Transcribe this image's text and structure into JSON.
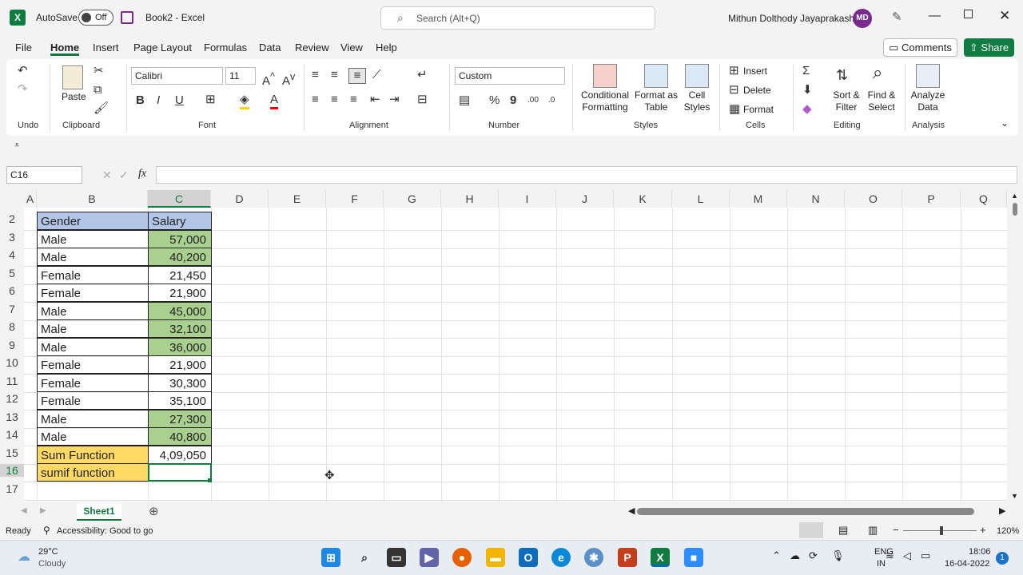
{
  "titlebar": {
    "autosave_label": "AutoSave",
    "autosave_state": "Off",
    "doc_title": "Book2  -  Excel",
    "search_placeholder": "Search (Alt+Q)",
    "user_name": "Mithun Dolthody Jayaprakash",
    "user_initials": "MD"
  },
  "menu": {
    "items": [
      "File",
      "Home",
      "Insert",
      "Page Layout",
      "Formulas",
      "Data",
      "Review",
      "View",
      "Help"
    ],
    "active": "Home",
    "comments_label": "Comments",
    "share_label": "Share"
  },
  "ribbon": {
    "groups": {
      "undo": "Undo",
      "clipboard": "Clipboard",
      "font": "Font",
      "alignment": "Alignment",
      "number": "Number",
      "styles": "Styles",
      "cells": "Cells",
      "editing": "Editing",
      "analysis": "Analysis"
    },
    "paste_label": "Paste",
    "font_name": "Calibri",
    "font_size": "11",
    "number_format": "Custom",
    "conditional_formatting": [
      "Conditional",
      "Formatting"
    ],
    "format_as_table": [
      "Format as",
      "Table"
    ],
    "cell_styles": [
      "Cell",
      "Styles"
    ],
    "insert_label": "Insert",
    "delete_label": "Delete",
    "format_label": "Format",
    "sort_filter": [
      "Sort &",
      "Filter"
    ],
    "find_select": [
      "Find &",
      "Select"
    ],
    "analyze_data": [
      "Analyze",
      "Data"
    ]
  },
  "formula_bar": {
    "name_box": "C16",
    "fx_label": "fx",
    "value": ""
  },
  "columns": [
    "A",
    "B",
    "C",
    "D",
    "E",
    "F",
    "G",
    "H",
    "I",
    "J",
    "K",
    "L",
    "M",
    "N",
    "O",
    "P",
    "Q"
  ],
  "row_numbers": [
    "2",
    "3",
    "4",
    "5",
    "6",
    "7",
    "8",
    "9",
    "10",
    "11",
    "12",
    "13",
    "14",
    "15",
    "16",
    "17"
  ],
  "table": {
    "header": {
      "gender": "Gender",
      "salary": "Salary"
    },
    "rows": [
      {
        "gender": "Male",
        "salary": "57,000",
        "highlight": true
      },
      {
        "gender": "Male",
        "salary": "40,200",
        "highlight": true
      },
      {
        "gender": "Female",
        "salary": "21,450",
        "highlight": false
      },
      {
        "gender": "Female",
        "salary": "21,900",
        "highlight": false
      },
      {
        "gender": "Male",
        "salary": "45,000",
        "highlight": true
      },
      {
        "gender": "Male",
        "salary": "32,100",
        "highlight": true
      },
      {
        "gender": "Male",
        "salary": "36,000",
        "highlight": true
      },
      {
        "gender": "Female",
        "salary": "21,900",
        "highlight": false
      },
      {
        "gender": "Female",
        "salary": "30,300",
        "highlight": false
      },
      {
        "gender": "Female",
        "salary": "35,100",
        "highlight": false
      },
      {
        "gender": "Male",
        "salary": "27,300",
        "highlight": true
      },
      {
        "gender": "Male",
        "salary": "40,800",
        "highlight": true
      }
    ],
    "sum_label": "Sum Function",
    "sum_value": "4,09,050",
    "sumif_label": "sumif function",
    "sumif_value": ""
  },
  "colors": {
    "header_fill": "#b4c6e7",
    "male_fill": "#a9d08e",
    "function_fill": "#ffd966",
    "excel_green": "#107c41"
  },
  "sheet_tab": "Sheet1",
  "status": {
    "ready": "Ready",
    "accessibility": "Accessibility: Good to go",
    "zoom": "120%"
  },
  "taskbar": {
    "weather_temp": "29°C",
    "weather_desc": "Cloudy",
    "lang_1": "ENG",
    "lang_2": "IN",
    "time": "18:06",
    "date": "16-04-2022",
    "notification_count": "1"
  }
}
